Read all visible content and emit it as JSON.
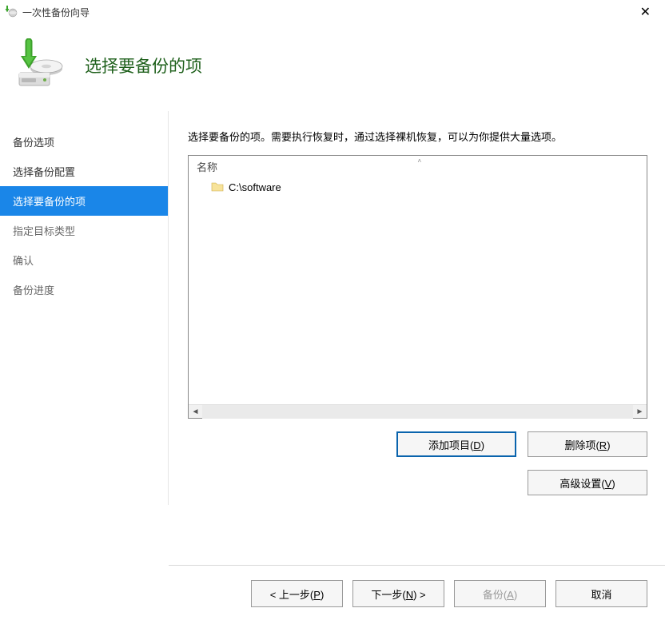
{
  "window": {
    "title": "一次性备份向导"
  },
  "header": {
    "title": "选择要备份的项"
  },
  "sidebar": {
    "items": [
      {
        "label": "备份选项"
      },
      {
        "label": "选择备份配置"
      },
      {
        "label": "选择要备份的项"
      },
      {
        "label": "指定目标类型"
      },
      {
        "label": "确认"
      },
      {
        "label": "备份进度"
      }
    ]
  },
  "main": {
    "instruction": "选择要备份的项。需要执行恢复时，通过选择裸机恢复，可以为你提供大量选项。",
    "column_header": "名称",
    "items": [
      {
        "path": "C:\\software"
      }
    ]
  },
  "buttons": {
    "add_item": "添加项目(D)",
    "remove_item": "删除项(R)",
    "advanced": "高级设置(V)",
    "prev": "< 上一步(P)",
    "next": "下一步(N) >",
    "backup": "备份(A)",
    "cancel": "取消"
  }
}
